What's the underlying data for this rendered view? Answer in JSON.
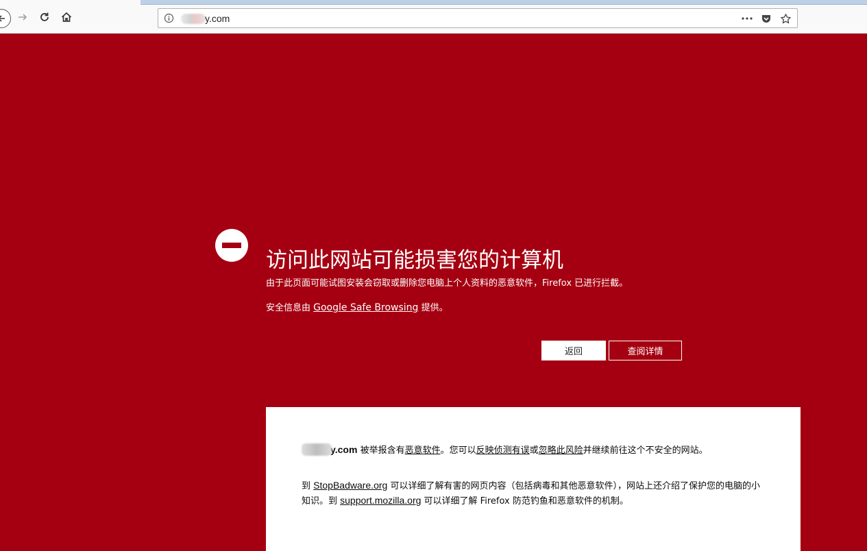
{
  "browser": {
    "url_visible": "y.com"
  },
  "warning": {
    "title": "访问此网站可能损害您的计算机",
    "description": "由于此页面可能试图安装会窃取或删除您电脑上个人资料的恶意软件，Firefox 已进行拦截。",
    "advisory_prefix": "安全信息由 ",
    "advisory_link": "Google Safe Browsing",
    "advisory_suffix": " 提供。",
    "back_button": "返回",
    "details_button": "查阅详情"
  },
  "details": {
    "site": "y.com",
    "p1_text1": " 被举报含有",
    "p1_link1": "恶意软件",
    "p1_text2": "。您可以",
    "p1_link2": "反映侦测有误",
    "p1_text3": "或",
    "p1_link3": "忽略此风险",
    "p1_text4": "并继续前往这个不安全的网站。",
    "p2_text1": "到 ",
    "p2_link1": "StopBadware.org",
    "p2_text2": " 可以详细了解有害的网页内容（包括病毒和其他恶意软件），网站上还介绍了保护您的电脑的小知识。到 ",
    "p2_link2": "support.mozilla.org",
    "p2_text3": " 可以详细了解 Firefox 防范钓鱼和恶意软件的机制。"
  },
  "colors": {
    "background": "#a50011",
    "text_on_bg": "#ffffff",
    "panel": "#ffffff"
  }
}
